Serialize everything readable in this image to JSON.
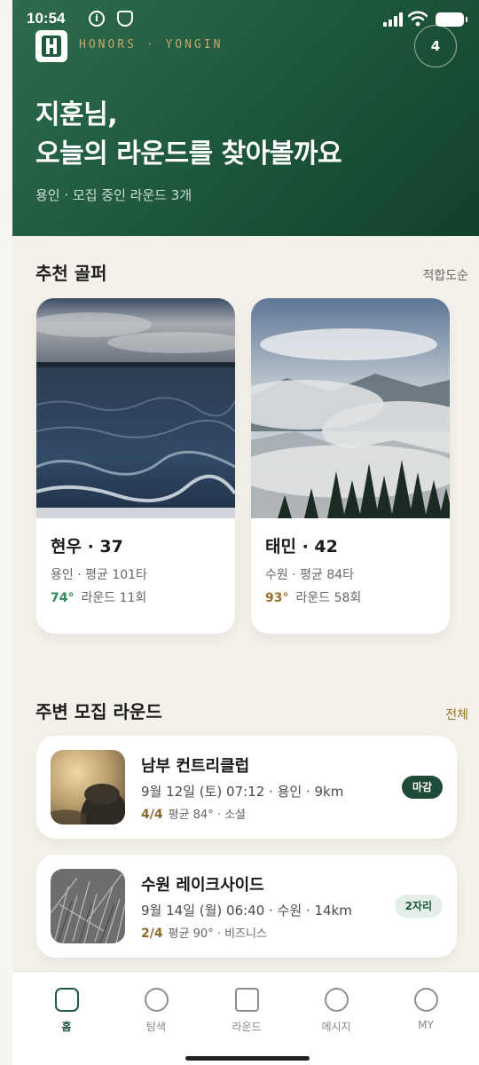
{
  "status": {
    "time": "10:54"
  },
  "header": {
    "brand": "HONORS · YONGIN",
    "notification_count": "4",
    "greeting_line1": "지훈님,",
    "greeting_line2": "오늘의 라운드를 찾아볼까요",
    "subtitle": "용인 · 모집 중인 라운드 3개"
  },
  "recommended": {
    "title": "추천 골퍼",
    "sort_label": "적합도순",
    "golfers": [
      {
        "name": "현우 · 37",
        "info": "용인 · 평균 101타",
        "score": "74°",
        "rounds": "라운드 11회",
        "score_color": "#2e8a5e",
        "image": "ocean"
      },
      {
        "name": "태민 · 42",
        "info": "수원 · 평균 84타",
        "score": "93°",
        "rounds": "라운드 58회",
        "score_color": "#9a7330",
        "image": "misty-forest"
      }
    ]
  },
  "nearby": {
    "title": "주변 모집 라운드",
    "all_label": "전체",
    "rounds": [
      {
        "name": "남부 컨트리클럽",
        "meta": "9월 12일 (토) 07:12 · 용인 · 9km",
        "count": "4/4",
        "detail": "평균 84° · 소셜",
        "badge": "마감",
        "badge_style": "dark",
        "image": "misty-tree"
      },
      {
        "name": "수원 레이크사이드",
        "meta": "9월 14일 (월) 06:40 · 수원 · 14km",
        "count": "2/4",
        "detail": "평균 90° · 비즈니스",
        "badge": "2자리",
        "badge_style": "light",
        "image": "grass-bw"
      }
    ]
  },
  "tabs": [
    {
      "label": "홈",
      "icon": "home-icon",
      "selected": true
    },
    {
      "label": "탐색",
      "icon": "explore-icon",
      "selected": false
    },
    {
      "label": "라운드",
      "icon": "round-icon",
      "selected": false
    },
    {
      "label": "메시지",
      "icon": "message-icon",
      "selected": false
    },
    {
      "label": "MY",
      "icon": "profile-icon",
      "selected": false
    }
  ],
  "colors": {
    "primary": "#1f5a3e",
    "accent_gold": "#c8a56a",
    "background": "#f4f1ea"
  }
}
